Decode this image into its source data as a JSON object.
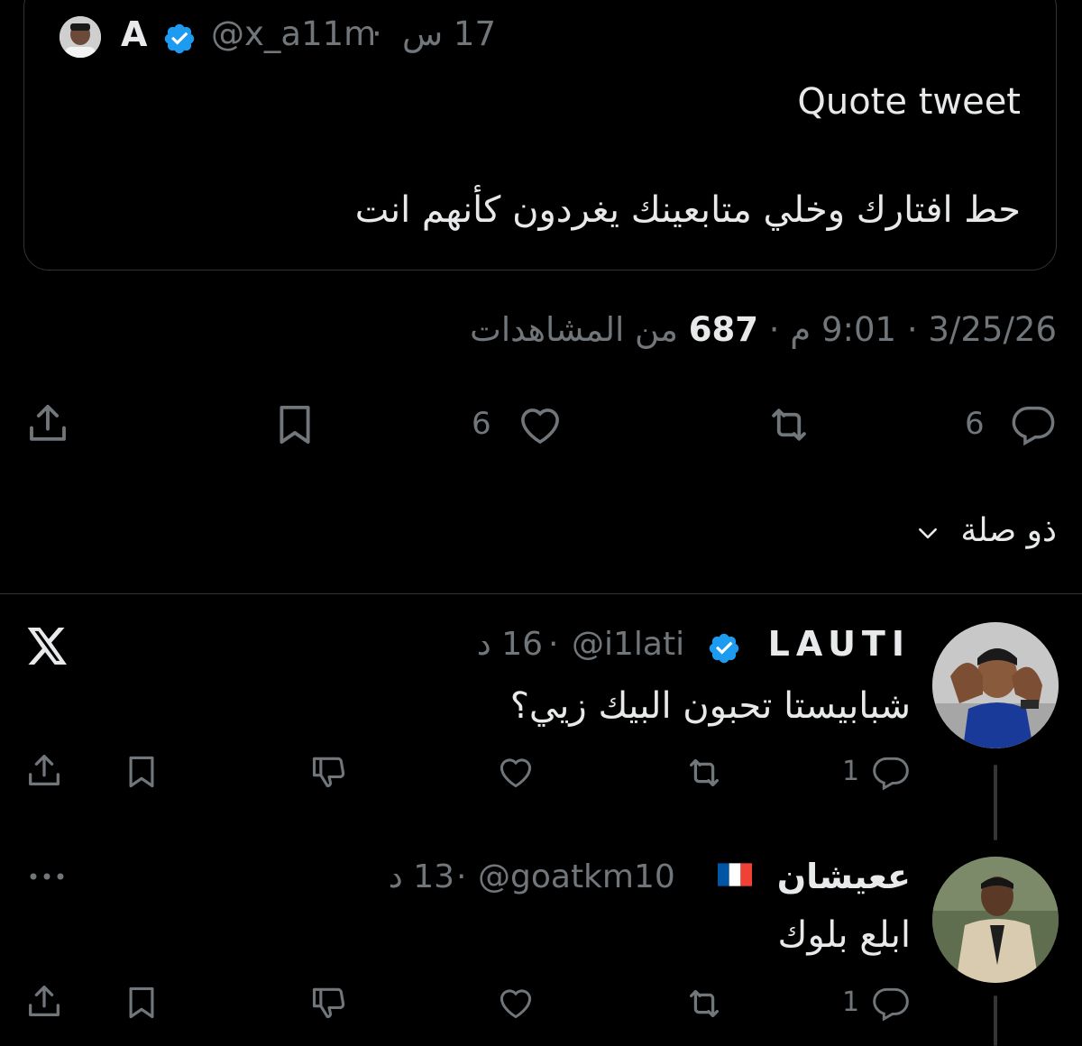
{
  "quoted": {
    "name": "A",
    "handle": "@x_a11m",
    "time": "17 س",
    "sep": "·",
    "line1": "Quote tweet",
    "line2": "حط افتارك وخلي متابعينك يغردون كأنهم انت"
  },
  "meta": {
    "date": "3/25/26",
    "time": "9:01 م",
    "views_count": "687",
    "views_label": "من المشاهدات",
    "sep": "·"
  },
  "actions": {
    "replies": "6",
    "likes": "6"
  },
  "related": {
    "label": "ذو صلة"
  },
  "replies": [
    {
      "name": "LAUTI",
      "handle": "@i1lati",
      "time": "16 د",
      "text": "شبابيستا تحبون البيك زيي؟",
      "reply_count": "1"
    },
    {
      "name": "ععيشان",
      "flag": "🇫🇷",
      "handle": "@goatkm10",
      "time": "13 د",
      "text": "ابلع بلوك",
      "reply_count": "1"
    }
  ],
  "colors": {
    "background": "#000000",
    "text": "#e7e9ea",
    "secondary": "#71767b",
    "verified": "#1d9bf0",
    "border": "#2f3336"
  }
}
